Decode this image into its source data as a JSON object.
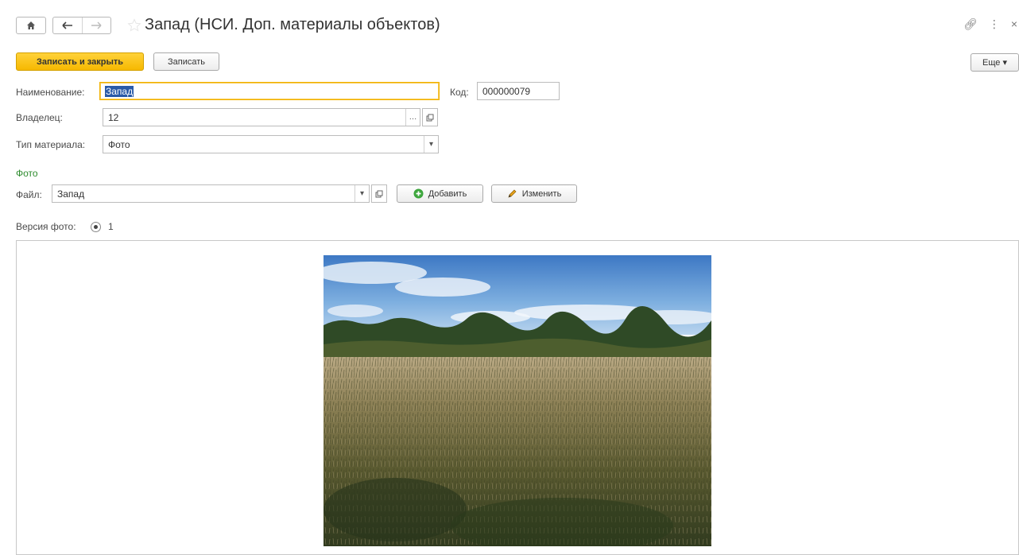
{
  "window": {
    "title": "Запад (НСИ. Доп. материалы объектов)",
    "actions": [
      "link-icon",
      "more-vert-icon",
      "close-icon"
    ]
  },
  "toolbar": {
    "save_close_label": "Записать и закрыть",
    "save_label": "Записать",
    "more_label": "Еще ▾"
  },
  "form": {
    "name_label": "Наименование:",
    "name_value": "Запад",
    "code_label": "Код:",
    "code_value": "000000079",
    "owner_label": "Владелец:",
    "owner_value": "12",
    "type_label": "Тип материала:",
    "type_value": "Фото"
  },
  "photo_group": {
    "title": "Фото",
    "file_label": "Файл:",
    "file_value": "Запад",
    "add_label": "Добавить",
    "edit_label": "Изменить",
    "version_label": "Версия фото:",
    "version_value": "1"
  },
  "colors": {
    "accent": "#f6b800",
    "group_title": "#2e8b2e",
    "selection": "#2a5aa8"
  }
}
